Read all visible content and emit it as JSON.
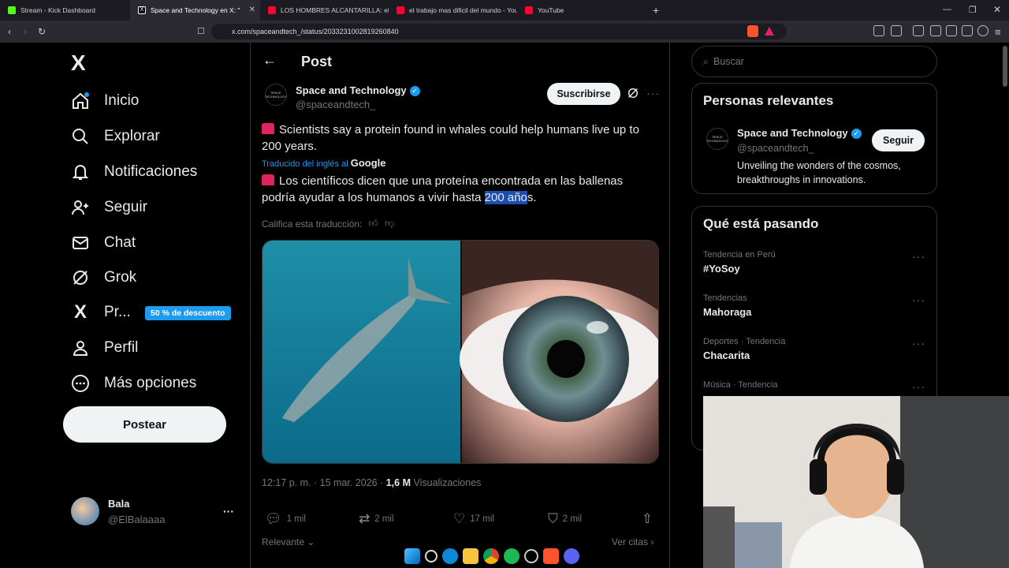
{
  "browser": {
    "tabs": [
      {
        "label": "Stream - Kick Dashboard",
        "color": "#53fc18",
        "active": false
      },
      {
        "label": "Space and Technology en X: \"",
        "color": "#ffffff",
        "active": true
      },
      {
        "label": "LOS HOMBRES ALCANTARILLA: el tra",
        "color": "#ff0033",
        "active": false
      },
      {
        "label": "el trabajo mas dificil del mundo - You",
        "color": "#ff0033",
        "active": false
      },
      {
        "label": "YouTube",
        "color": "#ff0033",
        "active": false
      }
    ],
    "new_tab": "+",
    "url": "x.com/spaceandtech_/status/2033231002819260840"
  },
  "sidebar": {
    "logo": "X",
    "items": [
      {
        "label": "Inicio",
        "icon": "home-icon"
      },
      {
        "label": "Explorar",
        "icon": "search-icon"
      },
      {
        "label": "Notificaciones",
        "icon": "bell-icon"
      },
      {
        "label": "Seguir",
        "icon": "add-person-icon"
      },
      {
        "label": "Chat",
        "icon": "mail-icon"
      },
      {
        "label": "Grok",
        "icon": "grok-icon"
      },
      {
        "label": "Pr...",
        "icon": "x-premium-icon"
      },
      {
        "label": "Perfil",
        "icon": "person-icon"
      },
      {
        "label": "Más opciones",
        "icon": "more-circle-icon"
      }
    ],
    "promo_badge": "50 % de descuento",
    "post_button": "Postear",
    "user": {
      "name": "Bala",
      "handle": "@ElBalaaaa",
      "more": "···"
    }
  },
  "post": {
    "header_title": "Post",
    "account": {
      "name": "Space and Technology",
      "handle": "@spaceandtech_",
      "avatar_text": "SPACE TECHNOLOGY"
    },
    "subscribe_label": "Suscribirse",
    "text_original": "Scientists say a protein found in whales could help humans live up to 200 years.",
    "translated_prefix": "Traducido del inglés al",
    "translated_brand": "Google",
    "text_translated_before": "Los científicos dicen que una proteína encontrada en las ballenas podría ayudar a los humanos a vivir hasta ",
    "text_translated_highlight": "200 año",
    "text_translated_after": "s.",
    "rate_translation": "Califica esta traducción:",
    "timestamp": "12:17 p. m. · 15 mar. 2026 ·",
    "views_count": "1,6 M",
    "views_label": "Visualizaciones",
    "stats": {
      "replies": "1 mil",
      "reposts": "2 mil",
      "likes": "17 mil",
      "bookmarks": "2 mil"
    },
    "relevant_label": "Relevante",
    "view_quotes": "Ver citas"
  },
  "right": {
    "search_placeholder": "Buscar",
    "relevant_title": "Personas relevantes",
    "relevant_person": {
      "name": "Space and Technology",
      "handle": "@spaceandtech_",
      "bio": "Unveiling the wonders of the cosmos, breakthroughs in innovations."
    },
    "follow_label": "Seguir",
    "trending_title": "Qué está pasando",
    "trends": [
      {
        "category": "Tendencia en Perú",
        "name": "#YoSoy"
      },
      {
        "category": "Tendencias",
        "name": "Mahoraga"
      },
      {
        "category": "Deportes · Tendencia",
        "name": "Chacarita"
      },
      {
        "category": "Música · Tendencia",
        "name": ""
      }
    ]
  },
  "colors": {
    "accent": "#1d9bf0",
    "background": "#000000",
    "border": "#2f3336",
    "muted": "#71767b"
  }
}
